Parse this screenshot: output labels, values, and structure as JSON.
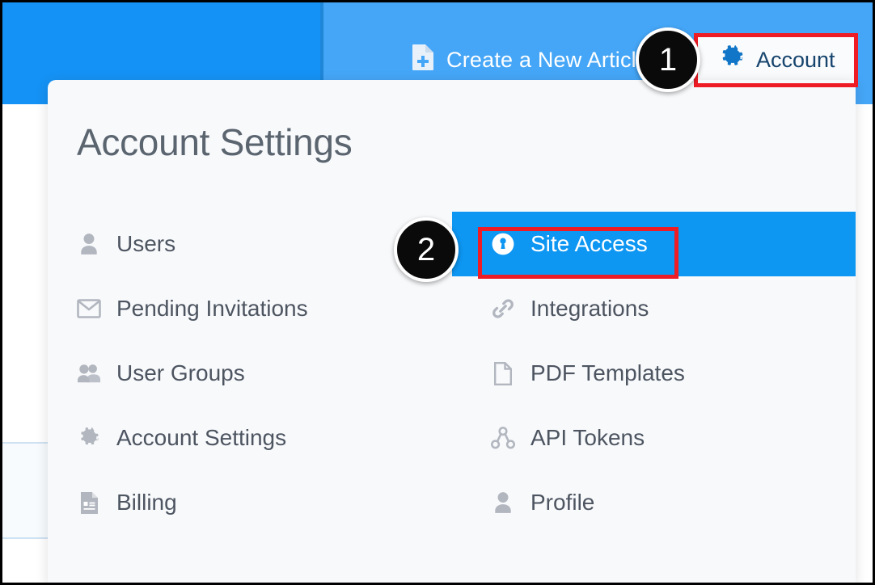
{
  "topbar": {
    "create_article": {
      "label": "Create a New Article",
      "icon": "file-plus-icon"
    },
    "account": {
      "label": "Account",
      "icon": "gear-icon"
    },
    "colors": {
      "left_blue": "#1592f5",
      "right_blue": "#45a6f7",
      "divider_blue": "#1f86d8"
    }
  },
  "panel": {
    "title": "Account Settings",
    "background": "#f8f9fb",
    "title_color": "#5b6570",
    "active_color": "#0d96f2",
    "left_column": [
      {
        "label": "Users",
        "icon": "user-icon",
        "active": false
      },
      {
        "label": "Pending Invitations",
        "icon": "envelope-icon",
        "active": false
      },
      {
        "label": "User Groups",
        "icon": "users-group-icon",
        "active": false
      },
      {
        "label": "Account Settings",
        "icon": "gear-icon",
        "active": false
      },
      {
        "label": "Billing",
        "icon": "invoice-icon",
        "active": false
      }
    ],
    "right_column": [
      {
        "label": "Site Access",
        "icon": "lock-keyhole-icon",
        "active": true
      },
      {
        "label": "Integrations",
        "icon": "link-icon",
        "active": false
      },
      {
        "label": "PDF Templates",
        "icon": "file-icon",
        "active": false
      },
      {
        "label": "API Tokens",
        "icon": "sitemap-icon",
        "active": false
      },
      {
        "label": "Profile",
        "icon": "user-icon",
        "active": false
      }
    ]
  },
  "annotations": {
    "highlight_color": "#ee1c25",
    "badge_color": "#0a0a0a",
    "steps": [
      {
        "number": "1",
        "target": "Account"
      },
      {
        "number": "2",
        "target": "Site Access"
      }
    ]
  }
}
